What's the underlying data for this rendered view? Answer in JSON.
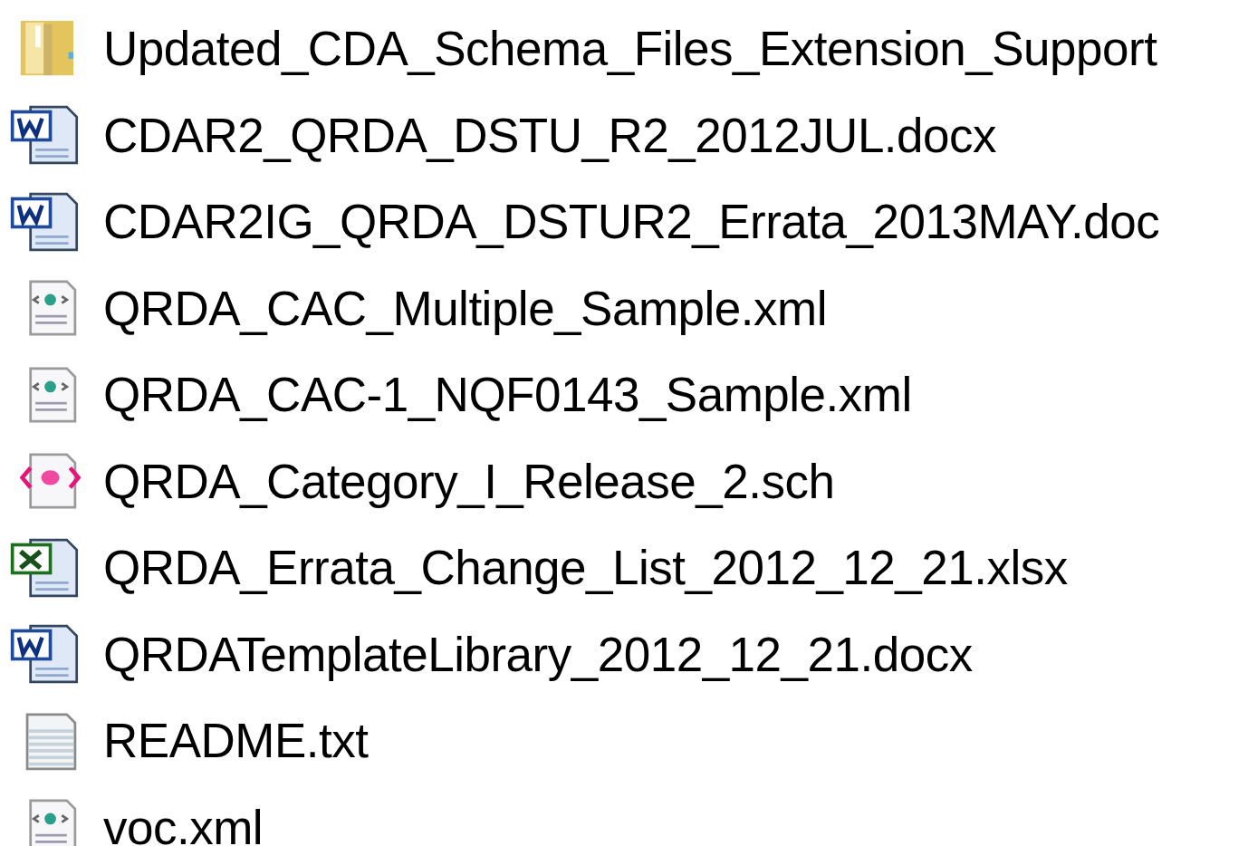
{
  "files": [
    {
      "kind": "folder",
      "name": "Updated_CDA_Schema_Files_Extension_Support"
    },
    {
      "kind": "word",
      "name": "CDAR2_QRDA_DSTU_R2_2012JUL.docx"
    },
    {
      "kind": "word",
      "name": "CDAR2IG_QRDA_DSTUR2_Errata_2013MAY.doc"
    },
    {
      "kind": "xml",
      "name": "QRDA_CAC_Multiple_Sample.xml"
    },
    {
      "kind": "xml",
      "name": "QRDA_CAC-1_NQF0143_Sample.xml"
    },
    {
      "kind": "schematron",
      "name": "QRDA_Category_I_Release_2.sch"
    },
    {
      "kind": "excel",
      "name": "QRDA_Errata_Change_List_2012_12_21.xlsx"
    },
    {
      "kind": "word",
      "name": "QRDATemplateLibrary_2012_12_21.docx"
    },
    {
      "kind": "text",
      "name": "README.txt"
    },
    {
      "kind": "xml",
      "name": "voc.xml"
    }
  ]
}
